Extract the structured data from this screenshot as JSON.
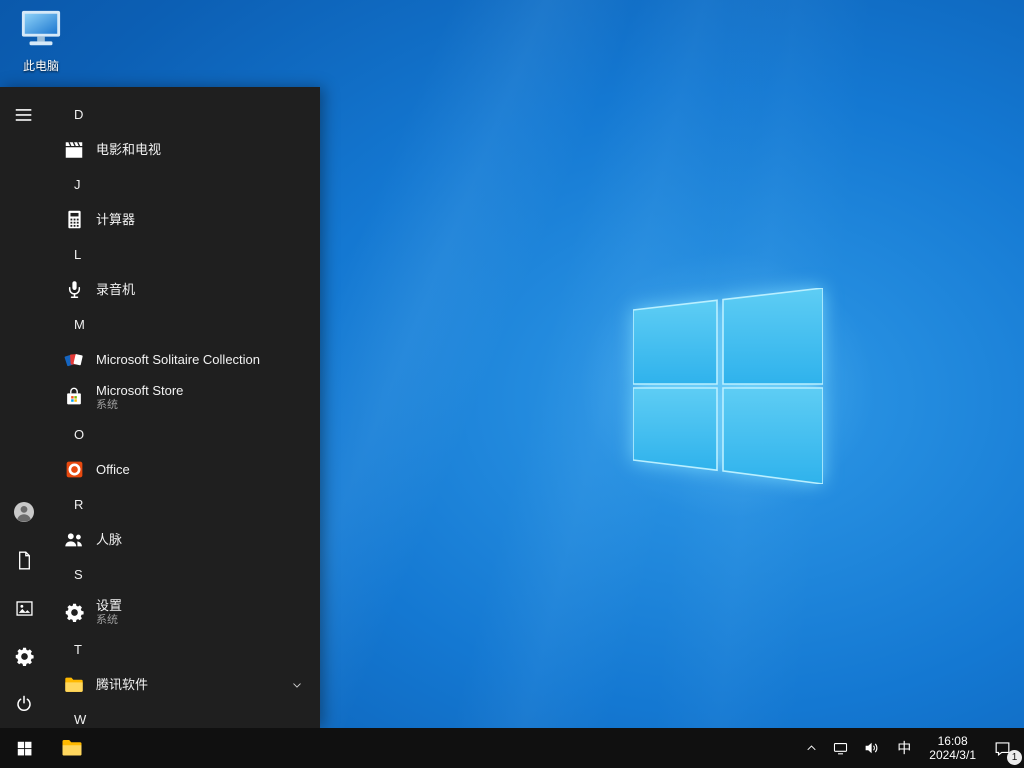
{
  "desktop": {
    "icons": [
      {
        "label": "此电脑"
      }
    ]
  },
  "start_menu": {
    "sections": [
      {
        "letter": "D",
        "apps": [
          {
            "name": "电影和电视"
          }
        ]
      },
      {
        "letter": "J",
        "apps": [
          {
            "name": "计算器"
          }
        ]
      },
      {
        "letter": "L",
        "apps": [
          {
            "name": "录音机"
          }
        ]
      },
      {
        "letter": "M",
        "apps": [
          {
            "name": "Microsoft Solitaire Collection"
          },
          {
            "name": "Microsoft Store",
            "subtitle": "系统"
          }
        ]
      },
      {
        "letter": "O",
        "apps": [
          {
            "name": "Office"
          }
        ]
      },
      {
        "letter": "R",
        "apps": [
          {
            "name": "人脉"
          }
        ]
      },
      {
        "letter": "S",
        "apps": [
          {
            "name": "设置",
            "subtitle": "系统"
          }
        ]
      },
      {
        "letter": "T",
        "apps": [
          {
            "name": "腾讯软件",
            "expandable": true
          }
        ]
      },
      {
        "letter": "W",
        "apps": []
      }
    ],
    "icons": {
      "hamburger": "menu",
      "user": "person-circle",
      "documents": "document",
      "pictures": "picture",
      "settings": "gear",
      "power": "power-symbol"
    }
  },
  "taskbar": {
    "ime_indicator": "中",
    "clock": {
      "time": "16:08",
      "date": "2024/3/1"
    },
    "notification_badge": "1",
    "icons": {
      "start": "windows-logo",
      "file_explorer": "folder",
      "tray_chevron": "chevron-up",
      "network": "display",
      "volume": "speaker",
      "action_center": "chat-bubble"
    }
  },
  "colors": {
    "accent_blue": "#0c5fb4",
    "logo_blue": "#3fc0f0",
    "menu_bg": "#1f1f1f",
    "taskbar_bg": "#101010",
    "folder_yellow": "#ffb900"
  }
}
